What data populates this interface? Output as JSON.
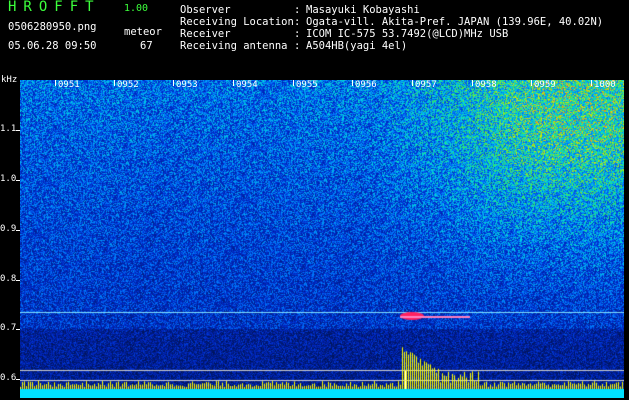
{
  "header": {
    "app_title": "HROFFT",
    "app_version": "1.00",
    "file_name": "0506280950.png",
    "meteor_label": "meteor",
    "timestamp": "05.06.28 09:50",
    "meteor_count": "67"
  },
  "info": [
    {
      "key": "Observer",
      "sep": ":",
      "value": "Masayuki Kobayashi"
    },
    {
      "key": "Receiving Location",
      "sep": ":",
      "value": "Ogata-vill. Akita-Pref. JAPAN (139.96E, 40.02N)"
    },
    {
      "key": "Receiver",
      "sep": ":",
      "value": "ICOM IC-575 53.7492(@LCD)MHz USB"
    },
    {
      "key": "Receiving antenna",
      "sep": ":",
      "value": "A504HB(yagi 4el)"
    }
  ],
  "axis": {
    "y_unit": "kHz",
    "y_ticks": [
      "1.1",
      "1.0",
      "0.9",
      "0.8",
      "0.7",
      "0.6"
    ],
    "x_ticks": [
      "0951",
      "0952",
      "0953",
      "0954",
      "0955",
      "0956",
      "0957",
      "0958",
      "0959",
      "1000"
    ]
  },
  "colors": {
    "title": "#3cff3c",
    "text": "#ffffff",
    "background_noise": "#0a1a8c",
    "meteor_echo": "#ff2060",
    "carrier_line": "#7fe0ff",
    "amplitude_bars": "#ffff00",
    "baseline": "#00e0ff"
  }
}
